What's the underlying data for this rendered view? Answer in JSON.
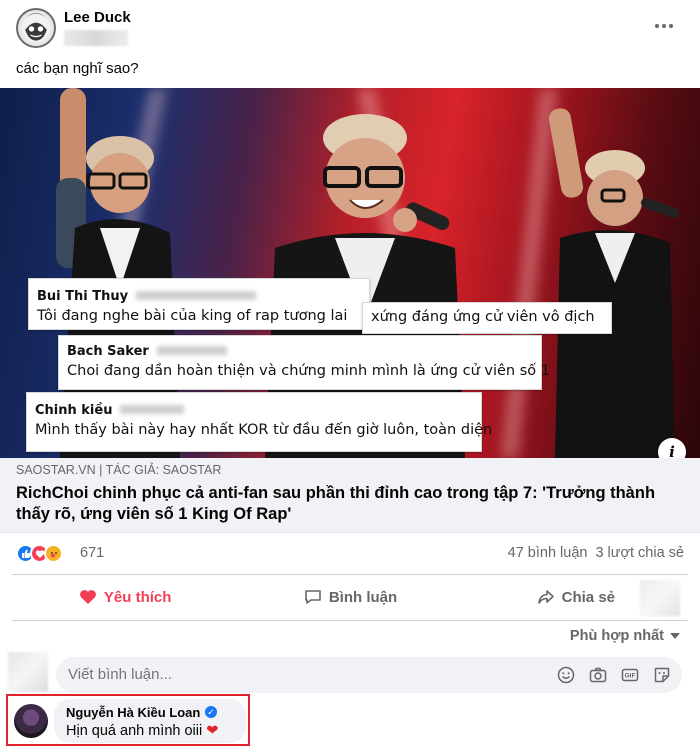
{
  "post": {
    "author": "Lee Duck",
    "text": "các bạn nghĩ sao?"
  },
  "media": {
    "comments": [
      {
        "name": "Bui Thi Thuy",
        "text": "Tôi đang nghe bài của king of rap tương lai"
      },
      {
        "name": "",
        "text": "xứng đáng ứng cử viên vô địch"
      },
      {
        "name": "Bach Saker",
        "text": "Choi đang dần hoàn thiện và chứng minh mình là ứng cử viên số 1"
      },
      {
        "name": "Chinh kiều",
        "text": "Mình thấy bài này hay nhất KOR từ đầu đến giờ luôn, toàn diện"
      }
    ],
    "info_icon": "i"
  },
  "link": {
    "source": "SAOSTAR.VN | TÁC GIẢ: SAOSTAR",
    "title": "RichChoi chinh phục cả anti-fan sau phần thi đỉnh cao trong tập 7: 'Trưởng thành thấy rõ, ứng viên số 1 King Of Rap'"
  },
  "stats": {
    "reaction_count": "671",
    "comments": "47 bình luận",
    "shares": "3 lượt chia sẻ"
  },
  "actions": {
    "like": "Yêu thích",
    "comment": "Bình luận",
    "share": "Chia sẻ"
  },
  "sort_label": "Phù hợp nhất",
  "composer": {
    "placeholder": "Viết bình luận..."
  },
  "comment": {
    "name": "Nguyễn Hà Kiều Loan",
    "text": "Hịn quá anh mình oiii",
    "heart": "❤"
  },
  "colors": {
    "accent_blue": "#1877f2",
    "love_red": "#f33e58",
    "highlight_red": "#e0242a"
  }
}
